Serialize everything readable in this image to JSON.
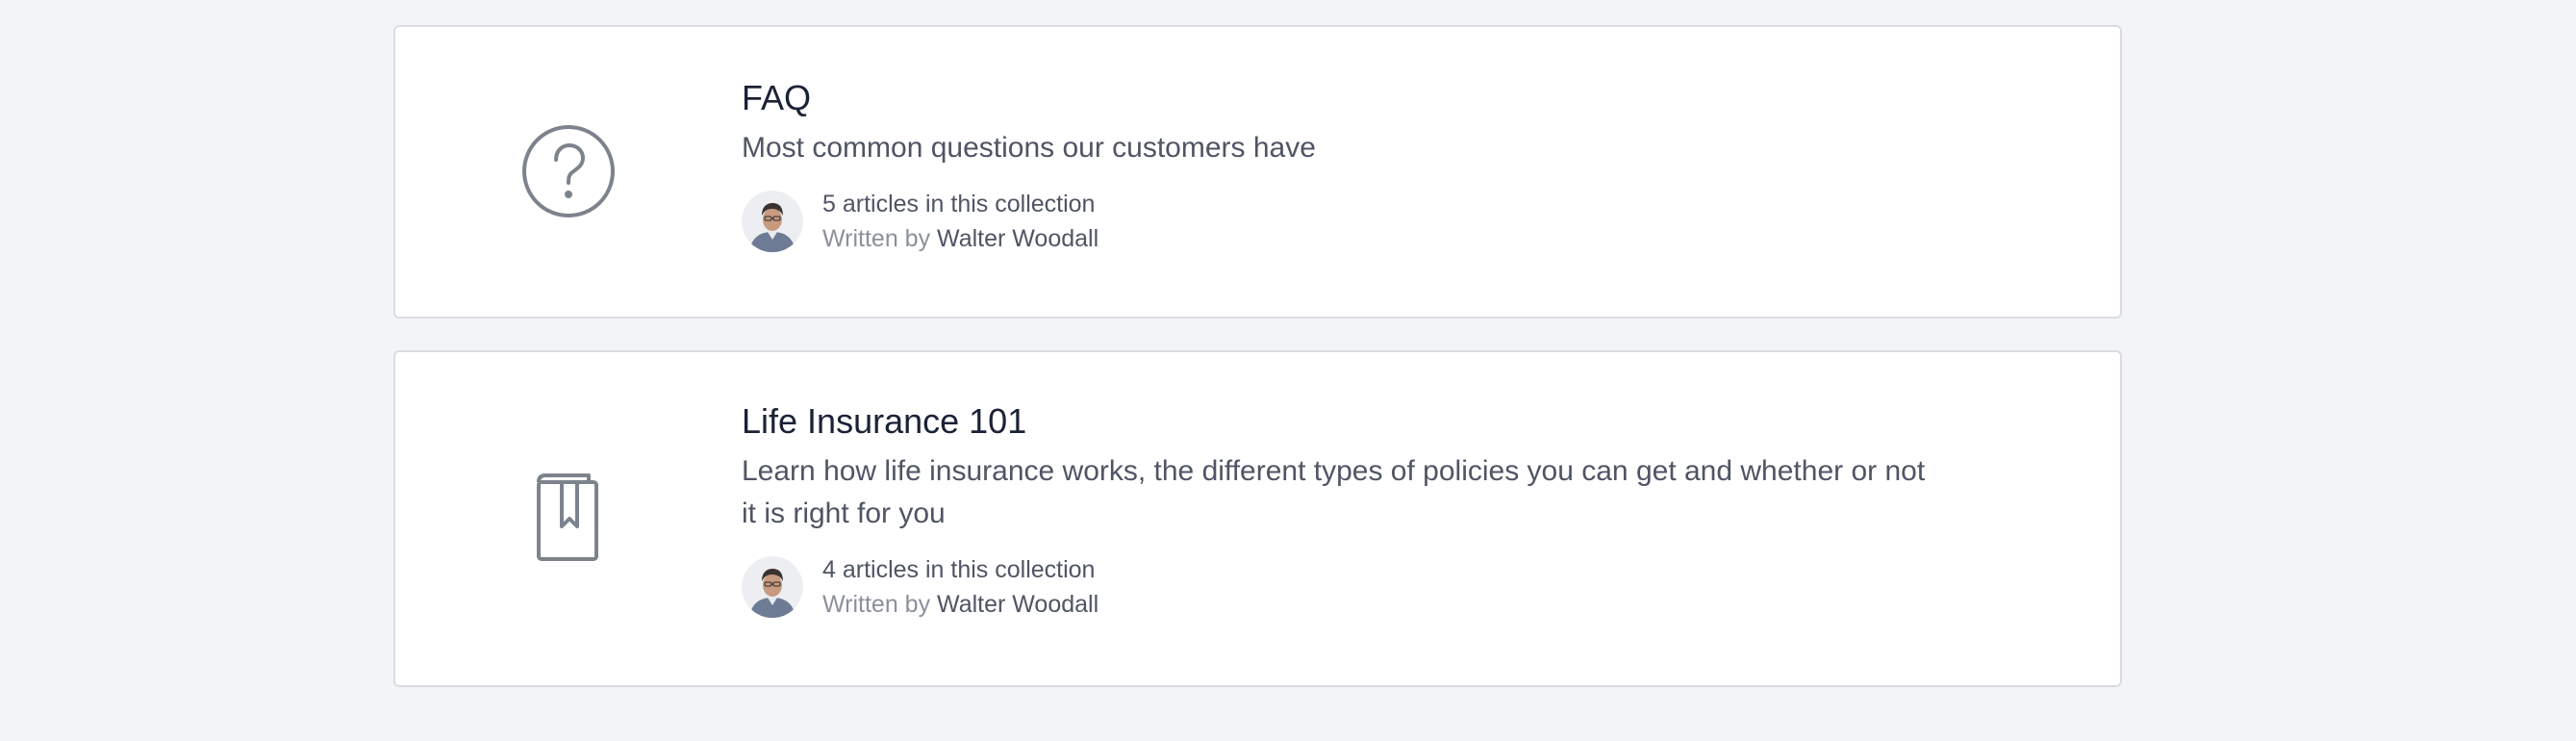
{
  "collections": [
    {
      "title": "FAQ",
      "description": "Most common questions our customers have",
      "icon": "question-circle-icon",
      "article_count": "5 articles in this collection",
      "written_by_prefix": "Written by",
      "author": "Walter Woodall"
    },
    {
      "title": "Life Insurance 101",
      "description": "Learn how life insurance works, the different types of policies you can get and whether or not it is right for you",
      "icon": "bookmark-book-icon",
      "article_count": "4 articles in this collection",
      "written_by_prefix": "Written by",
      "author": "Walter Woodall"
    }
  ],
  "colors": {
    "page_background": "#f3f4f6",
    "card_background": "#ffffff",
    "card_border": "#d9dce1",
    "title": "#1a2235",
    "body_text": "#4f5565",
    "muted_text": "#8b909b",
    "icon_stroke": "#7d838d"
  }
}
